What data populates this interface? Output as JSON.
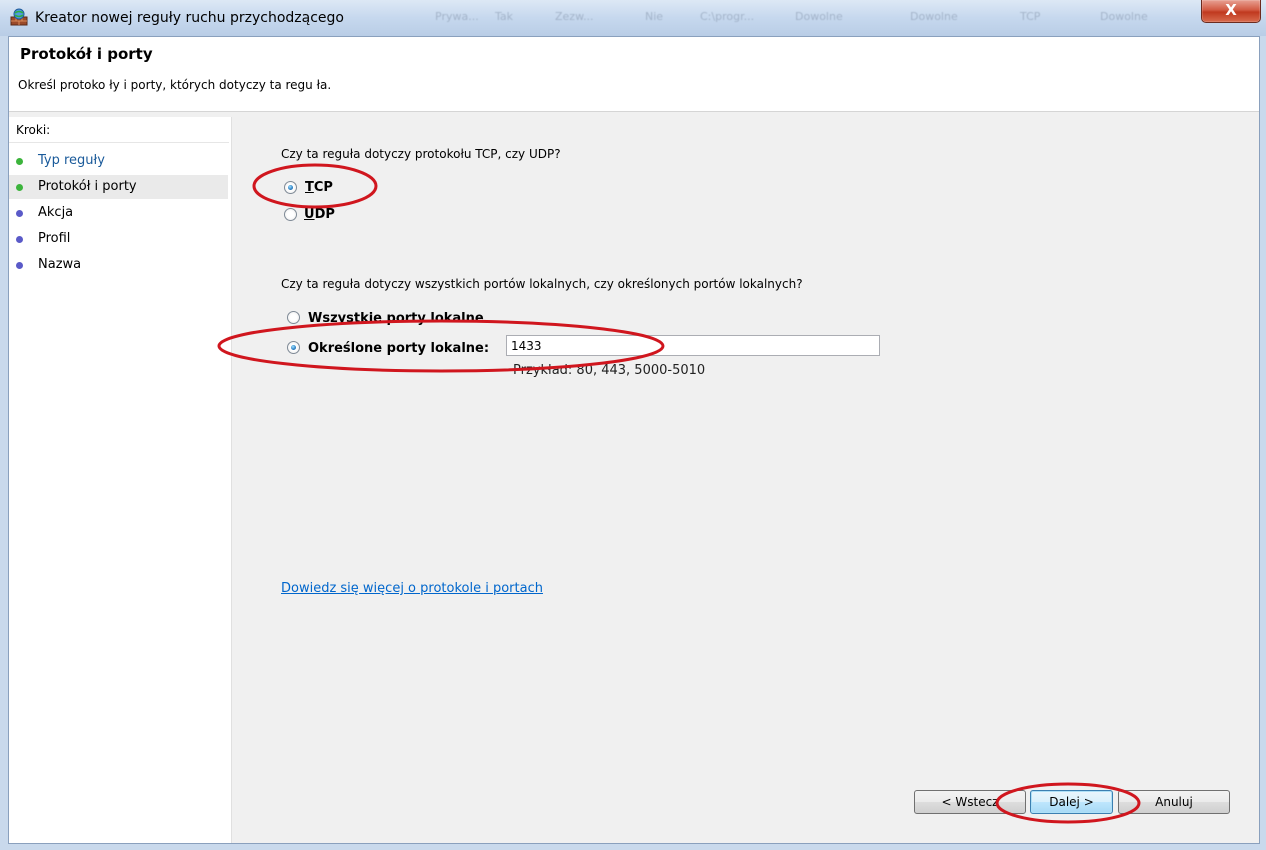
{
  "window": {
    "title": "Kreator nowej reguły ruchu przychodzącego",
    "close_label": "X",
    "background_columns": [
      "Prywa...",
      "Tak",
      "Zezw...",
      "Nie",
      "C:\\progr...",
      "Dowolne",
      "Dowolne",
      "TCP",
      "Dowolne"
    ]
  },
  "header": {
    "title": "Protokół i porty",
    "subtitle": "Określ protoko ły i porty, których dotyczy ta regu ła."
  },
  "steps": {
    "heading": "Kroki:",
    "items": [
      {
        "label": "Typ reguły",
        "status": "done",
        "color": "#3cb43c",
        "link_color": "#1a5a9a"
      },
      {
        "label": "Protokół i porty",
        "status": "current",
        "color": "#3cb43c",
        "link_color": "#000000"
      },
      {
        "label": "Akcja",
        "status": "pending",
        "color": "#5a5ac8",
        "link_color": "#000000"
      },
      {
        "label": "Profil",
        "status": "pending",
        "color": "#5a5ac8",
        "link_color": "#000000"
      },
      {
        "label": "Nazwa",
        "status": "pending",
        "color": "#5a5ac8",
        "link_color": "#000000"
      }
    ]
  },
  "protocol": {
    "question": "Czy ta reguła dotyczy protokołu TCP, czy UDP?",
    "tcp_label": "TCP",
    "udp_label": "UDP",
    "selected": "TCP"
  },
  "ports": {
    "question": "Czy ta reguła dotyczy wszystkich portów lokalnych, czy określonych portów lokalnych?",
    "all_label": "Wszystkie porty lokalne",
    "specific_label": "Określone porty lokalne:",
    "selected": "specific",
    "value": "1433",
    "example": "Przykład: 80, 443, 5000-5010"
  },
  "learn_more": "Dowiedz się więcej o protokole i portach",
  "buttons": {
    "back": "< Wstecz",
    "next": "Dalej >",
    "cancel": "Anuluj"
  },
  "annotation_color": "#d0161e"
}
